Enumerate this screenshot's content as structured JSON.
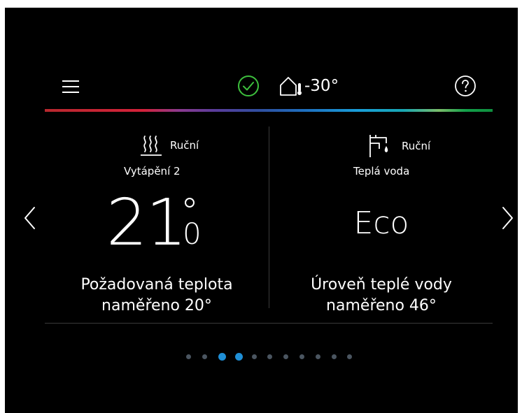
{
  "header": {
    "outdoor_temp": "-30°"
  },
  "panels": [
    {
      "mode": "Ruční",
      "zone": "Vytápění 2",
      "temp_int": "21",
      "temp_dec": "0",
      "desc_line1": "Požadovaná teplota",
      "desc_line2": "naměřeno 20°",
      "icon": "heating-icon"
    },
    {
      "mode": "Ruční",
      "zone": "Teplá voda",
      "value": "Eco",
      "desc_line1": "Úroveň teplé vody",
      "desc_line2": "naměřeno 46°",
      "icon": "hot-water-tap-icon"
    }
  ],
  "pager": {
    "total": 11,
    "active": [
      2,
      3
    ]
  },
  "colors": {
    "status_ok": "#3dbf3d",
    "pager_active": "#1f8fd6",
    "pager_inactive": "#4a5560"
  }
}
